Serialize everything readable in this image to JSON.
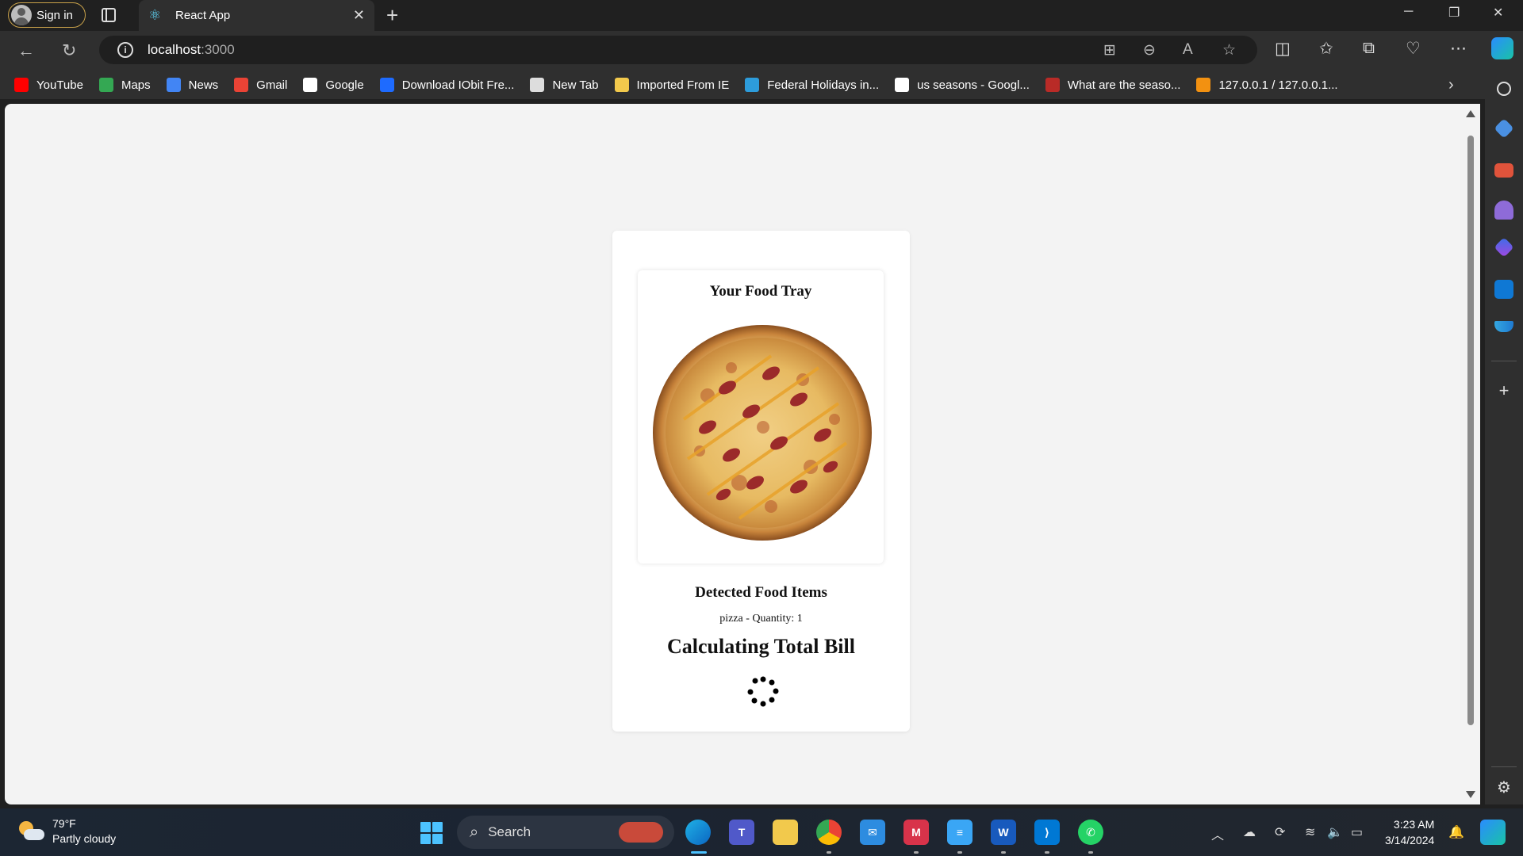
{
  "browser": {
    "signin_label": "Sign in",
    "tab_title": "React App",
    "url_host": "localhost",
    "url_port": ":3000"
  },
  "bookmarks": [
    {
      "label": "YouTube",
      "icon": "youtube-icon",
      "color": "#ff0000"
    },
    {
      "label": "Maps",
      "icon": "maps-icon",
      "color": "#34a853"
    },
    {
      "label": "News",
      "icon": "news-icon",
      "color": "#4285f4"
    },
    {
      "label": "Gmail",
      "icon": "gmail-icon",
      "color": "#ea4335"
    },
    {
      "label": "Google",
      "icon": "google-icon",
      "color": "#ffffff"
    },
    {
      "label": "Download IObit Fre...",
      "icon": "iobit-icon",
      "color": "#1e6bff"
    },
    {
      "label": "New Tab",
      "icon": "page-icon",
      "color": "#dddddd"
    },
    {
      "label": "Imported From IE",
      "icon": "folder-icon",
      "color": "#f2c94c"
    },
    {
      "label": "Federal Holidays in...",
      "icon": "calendar-icon",
      "color": "#2d9cdb"
    },
    {
      "label": "us seasons - Googl...",
      "icon": "google-icon",
      "color": "#ffffff"
    },
    {
      "label": "What are the seaso...",
      "icon": "quora-icon",
      "color": "#b92b27"
    },
    {
      "label": "127.0.0.1 / 127.0.0.1...",
      "icon": "phpmyadmin-icon",
      "color": "#f29111"
    }
  ],
  "app": {
    "tray_title": "Your Food Tray",
    "detected_title": "Detected Food Items",
    "item_line": "pizza - Quantity: 1",
    "calculating": "Calculating Total Bill"
  },
  "taskbar": {
    "temperature": "79°F",
    "condition": "Partly cloudy",
    "search_label": "Search",
    "time": "3:23 AM",
    "date": "3/14/2024"
  },
  "colors": {
    "page_bg": "#f3f3f3",
    "card_bg": "#ffffff",
    "accent": "#4cc2ff"
  }
}
